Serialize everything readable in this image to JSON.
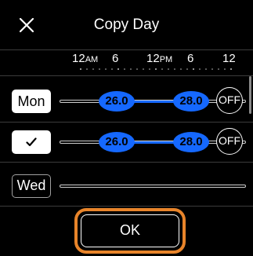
{
  "header": {
    "title": "Copy Day",
    "close_icon": "close-icon"
  },
  "timeline": {
    "labels": [
      {
        "main": "12",
        "suffix": "AM"
      },
      {
        "main": "6",
        "suffix": ""
      },
      {
        "main": "12",
        "suffix": "PM"
      },
      {
        "main": "6",
        "suffix": ""
      },
      {
        "main": "12",
        "suffix": ""
      }
    ]
  },
  "rows": [
    {
      "day": "Mon",
      "style": "solid",
      "set1": "26.0",
      "set2": "28.0",
      "off": "OFF"
    },
    {
      "day": "✓",
      "style": "check",
      "set1": "26.0",
      "set2": "28.0",
      "off": "OFF"
    },
    {
      "day": "Wed",
      "style": "outline"
    }
  ],
  "footer": {
    "ok_label": "OK"
  },
  "colors": {
    "accent": "#1568ff",
    "highlight": "#e8842a",
    "background": "#000000"
  }
}
